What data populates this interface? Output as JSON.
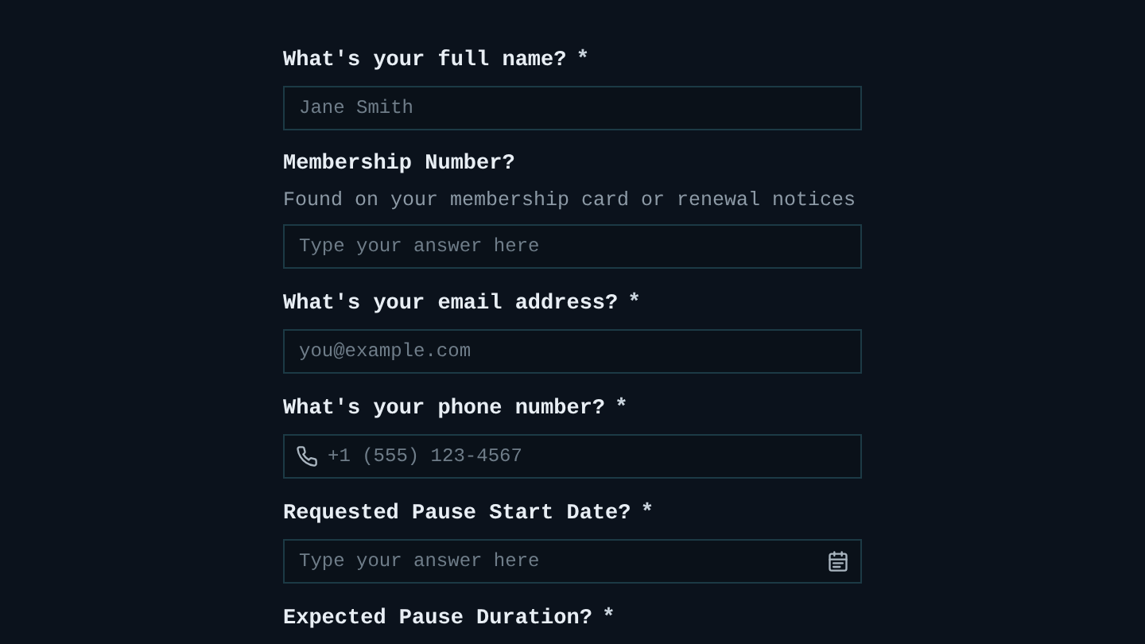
{
  "questions": [
    {
      "label": "What's your full name?",
      "required_mark": "*",
      "input": {
        "kind": "text",
        "placeholder": "Jane Smith"
      }
    },
    {
      "label": "Membership Number?",
      "hint": "Found on your membership card or renewal notices",
      "input": {
        "kind": "text",
        "placeholder": "Type your answer here"
      }
    },
    {
      "label": "What's your email address?",
      "required_mark": "*",
      "input": {
        "kind": "text",
        "placeholder": "you@example.com"
      }
    },
    {
      "label": "What's your phone number?",
      "required_mark": "*",
      "input": {
        "kind": "phone",
        "placeholder": "+1 (555) 123-4567"
      }
    },
    {
      "label": "Requested Pause Start Date?",
      "required_mark": "*",
      "input": {
        "kind": "date",
        "placeholder": "Type your answer here"
      }
    },
    {
      "label": "Expected Pause Duration?",
      "required_mark": "*"
    }
  ]
}
